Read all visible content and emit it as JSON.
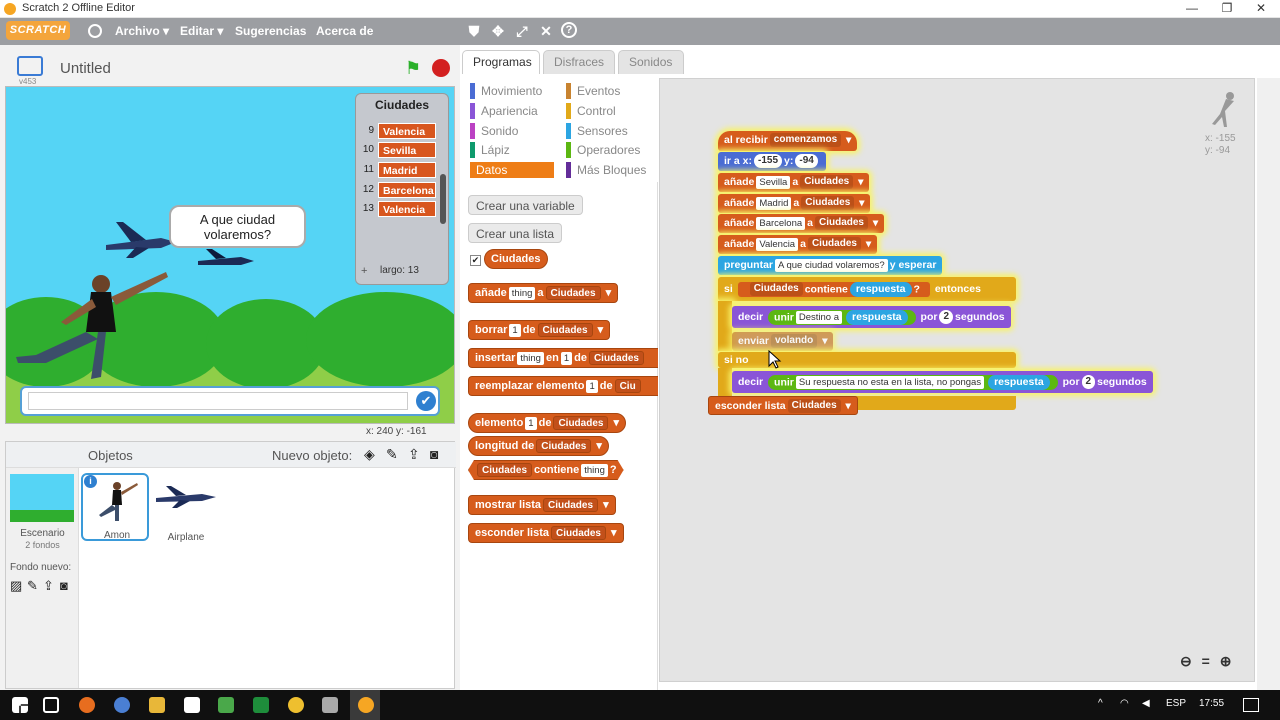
{
  "window": {
    "title": "Scratch 2 Offline Editor",
    "minimize": "—",
    "maximize": "❐",
    "close": "✕"
  },
  "menubar": {
    "logo": "SCRATCH",
    "items": [
      "Archivo ▾",
      "Editar ▾",
      "Sugerencias",
      "Acerca de"
    ]
  },
  "stage": {
    "project_title": "Untitled",
    "version": "v453",
    "speech": "A que ciudad volaremos?",
    "coords_label": "x: 240  y: -161"
  },
  "list_monitor": {
    "title": "Ciudades",
    "rows": [
      {
        "index": "9",
        "value": "Valencia"
      },
      {
        "index": "10",
        "value": "Sevilla"
      },
      {
        "index": "11",
        "value": "Madrid"
      },
      {
        "index": "12",
        "value": "Barcelona"
      },
      {
        "index": "13",
        "value": "Valencia"
      }
    ],
    "footer": "largo: 13"
  },
  "sprites": {
    "header": "Objetos",
    "new_label": "Nuevo objeto:",
    "stage_label": "Escenario",
    "stage_sub": "2 fondos",
    "new_backdrop": "Fondo nuevo:",
    "items": [
      {
        "name": "Amon",
        "selected": true
      },
      {
        "name": "Airplane",
        "selected": false
      }
    ]
  },
  "tabs": [
    "Programas",
    "Disfraces",
    "Sonidos"
  ],
  "categories_left": [
    "Movimiento",
    "Apariencia",
    "Sonido",
    "Lápiz",
    "Datos"
  ],
  "categories_right": [
    "Eventos",
    "Control",
    "Sensores",
    "Operadores",
    "Más Bloques"
  ],
  "category_colors": [
    "#4a6cd4",
    "#8a55d7",
    "#bb42c3",
    "#0e9a6c",
    "#ee7d16",
    "#c88330",
    "#e1a91a",
    "#2ca5e2",
    "#5cb712",
    "#632d99"
  ],
  "palette": {
    "make_variable": "Crear una variable",
    "make_list": "Crear una lista",
    "list_name": "Ciudades",
    "blocks": {
      "add": [
        "añade",
        "thing",
        "a",
        "Ciudades"
      ],
      "delete": [
        "borrar",
        "1",
        "de",
        "Ciudades"
      ],
      "insert": [
        "insertar",
        "thing",
        "en",
        "1",
        "de",
        "Ciudades"
      ],
      "replace": [
        "reemplazar elemento",
        "1",
        "de",
        "Ciu"
      ],
      "item": [
        "elemento",
        "1",
        "de",
        "Ciudades"
      ],
      "length": [
        "longitud de",
        "Ciudades"
      ],
      "contains": [
        "Ciudades",
        "contiene",
        "thing",
        "?"
      ],
      "show": [
        "mostrar lista",
        "Ciudades"
      ],
      "hide": [
        "esconder lista",
        "Ciudades"
      ]
    }
  },
  "script": {
    "hat": [
      "al recibir",
      "comenzamos"
    ],
    "goto": [
      "ir a x:",
      "-155",
      "y:",
      "-94"
    ],
    "adds": [
      [
        "añade",
        "Sevilla",
        "a",
        "Ciudades"
      ],
      [
        "añade",
        "Madrid",
        "a",
        "Ciudades"
      ],
      [
        "añade",
        "Barcelona",
        "a",
        "Ciudades"
      ],
      [
        "añade",
        "Valencia",
        "a",
        "Ciudades"
      ]
    ],
    "ask": [
      "preguntar",
      "A que ciudad volaremos?",
      "y esperar"
    ],
    "if": [
      "si",
      "Ciudades",
      "contiene",
      "respuesta",
      "?",
      "entonces"
    ],
    "say1": [
      "decir",
      "unir",
      "Destino a",
      "respuesta",
      "por",
      "2",
      "segundos"
    ],
    "broadcast": [
      "enviar",
      "volando"
    ],
    "else": "si no",
    "say2": [
      "decir",
      "unir",
      "Su respuesta no esta en la lista, no pongas",
      "respuesta",
      "por",
      "2",
      "segundos"
    ],
    "hide": [
      "esconder lista",
      "Ciudades"
    ]
  },
  "sprite_coords": {
    "x": "x: -155",
    "y": "y: -94"
  },
  "taskbar": {
    "lang": "ESP",
    "time": "17:55"
  }
}
